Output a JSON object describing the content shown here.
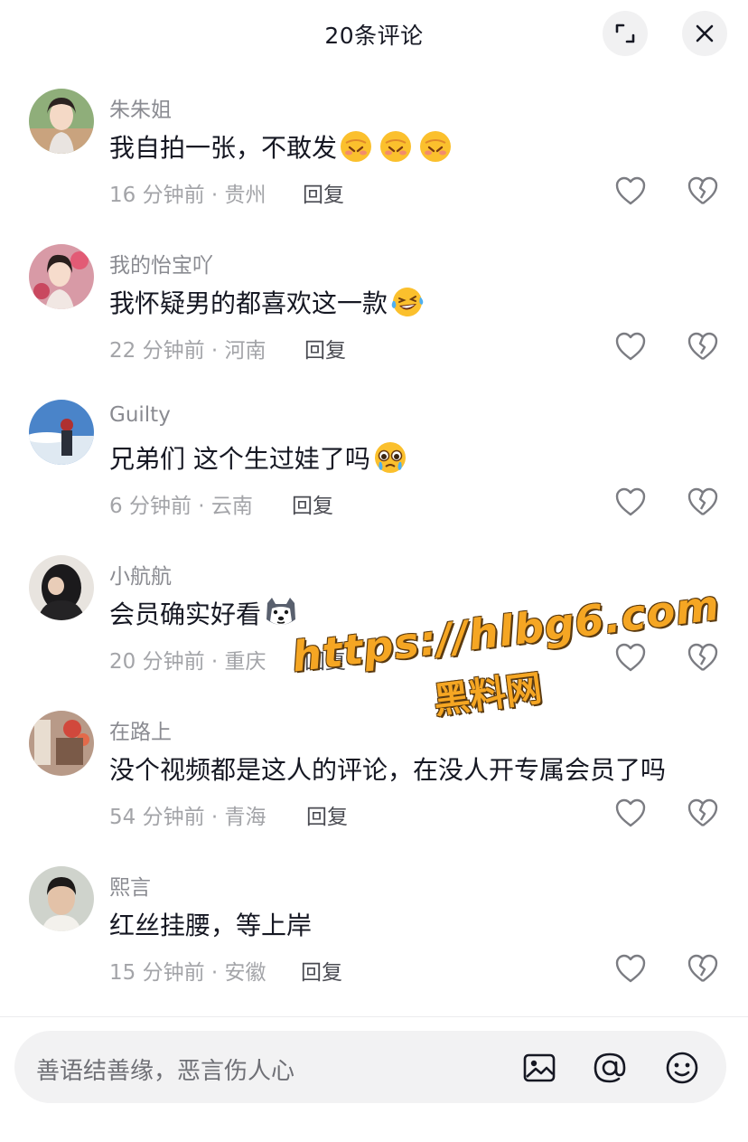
{
  "header": {
    "title": "20条评论"
  },
  "comments": [
    {
      "user": "朱朱姐",
      "text": "我自拍一张，不敢发",
      "emoji_count": 3,
      "emoji": "shy-face-emoji",
      "meta": "16 分钟前 · 贵州",
      "reply": "回复"
    },
    {
      "user": "我的怡宝吖",
      "text": "我怀疑男的都喜欢这一款",
      "emoji_count": 1,
      "emoji": "laughing-tears-emoji",
      "meta": "22 分钟前 · 河南",
      "reply": "回复"
    },
    {
      "user": "Guilty",
      "text": "兄弟们 这个生过娃了吗",
      "emoji_count": 1,
      "emoji": "pleading-face-emoji",
      "meta": "6 分钟前 · 云南",
      "reply": "回复"
    },
    {
      "user": "小航航",
      "text": "会员确实好看",
      "emoji_count": 1,
      "emoji": "husky-emoji",
      "meta": "20 分钟前 · 重庆",
      "reply": "回复"
    },
    {
      "user": "在路上",
      "text": "没个视频都是这人的评论，在没人开专属会员了吗",
      "emoji_count": 0,
      "emoji": "",
      "meta": "54 分钟前 · 青海",
      "reply": "回复"
    },
    {
      "user": "熙言",
      "text": "红丝挂腰，等上岸",
      "emoji_count": 0,
      "emoji": "",
      "meta": "15 分钟前 · 安徽",
      "reply": "回复"
    }
  ],
  "watermark": {
    "url": "https://hlbg6.com",
    "name": "黑料网"
  },
  "input": {
    "placeholder": "善语结善缘，恶言伤人心"
  },
  "icons": {
    "expand": "expand-icon",
    "close": "close-icon",
    "like": "heart-icon",
    "dislike": "broken-heart-icon",
    "image": "image-icon",
    "mention": "at-icon",
    "emoji": "smiley-icon"
  },
  "colors": {
    "text_primary": "#161823",
    "text_secondary": "#8a8b91",
    "watermark": "#f5a623"
  }
}
